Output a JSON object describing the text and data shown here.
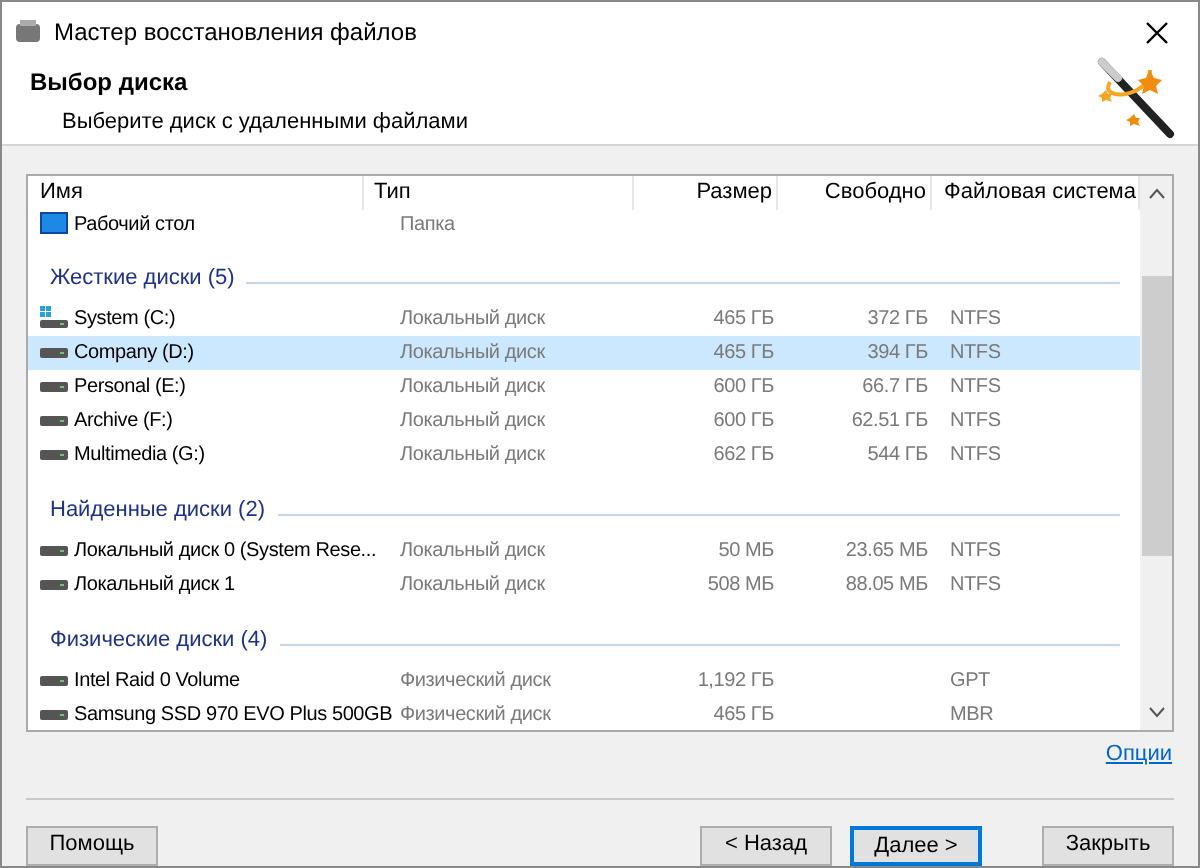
{
  "window": {
    "title": "Мастер восстановления файлов"
  },
  "header": {
    "title": "Выбор диска",
    "subtitle": "Выберите диск с удаленными файлами"
  },
  "table": {
    "columns": [
      "Имя",
      "Тип",
      "Размер",
      "Свободно",
      "Файловая система"
    ],
    "folders": [
      {
        "name": "Рабочий стол",
        "type": "Папка",
        "kind": "desktop",
        "selected": false
      }
    ],
    "groups": [
      {
        "title": "Жесткие диски (5)",
        "rows": [
          {
            "name": "System (C:)",
            "type": "Локальный диск",
            "size": "465 ГБ",
            "free": "372 ГБ",
            "fs": "NTFS",
            "kind": "system-disk",
            "selected": false
          },
          {
            "name": "Company (D:)",
            "type": "Локальный диск",
            "size": "465 ГБ",
            "free": "394 ГБ",
            "fs": "NTFS",
            "kind": "disk",
            "selected": true
          },
          {
            "name": "Personal (E:)",
            "type": "Локальный диск",
            "size": "600 ГБ",
            "free": "66.7 ГБ",
            "fs": "NTFS",
            "kind": "disk",
            "selected": false
          },
          {
            "name": "Archive (F:)",
            "type": "Локальный диск",
            "size": "600 ГБ",
            "free": "62.51 ГБ",
            "fs": "NTFS",
            "kind": "disk",
            "selected": false
          },
          {
            "name": "Multimedia (G:)",
            "type": "Локальный диск",
            "size": "662 ГБ",
            "free": "544 ГБ",
            "fs": "NTFS",
            "kind": "disk",
            "selected": false
          }
        ]
      },
      {
        "title": "Найденные диски (2)",
        "rows": [
          {
            "name": "Локальный диск 0 (System Rese...",
            "type": "Локальный диск",
            "size": "50 МБ",
            "free": "23.65 МБ",
            "fs": "NTFS",
            "kind": "disk",
            "selected": false
          },
          {
            "name": "Локальный диск 1",
            "type": "Локальный диск",
            "size": "508 МБ",
            "free": "88.05 МБ",
            "fs": "NTFS",
            "kind": "disk",
            "selected": false
          }
        ]
      },
      {
        "title": "Физические диски (4)",
        "rows": [
          {
            "name": "Intel Raid 0 Volume",
            "type": "Физический диск",
            "size": "1,192 ГБ",
            "fs": "GPT",
            "kind": "disk",
            "selected": false
          },
          {
            "name": "Samsung SSD 970 EVO Plus 500GB",
            "type": "Физический диск",
            "size": "465 ГБ",
            "fs": "MBR",
            "kind": "disk",
            "selected": false
          }
        ]
      }
    ]
  },
  "options_link": "Опции",
  "buttons": {
    "help": "Помощь",
    "back": "< Назад",
    "next": "Далее >",
    "close": "Закрыть"
  }
}
